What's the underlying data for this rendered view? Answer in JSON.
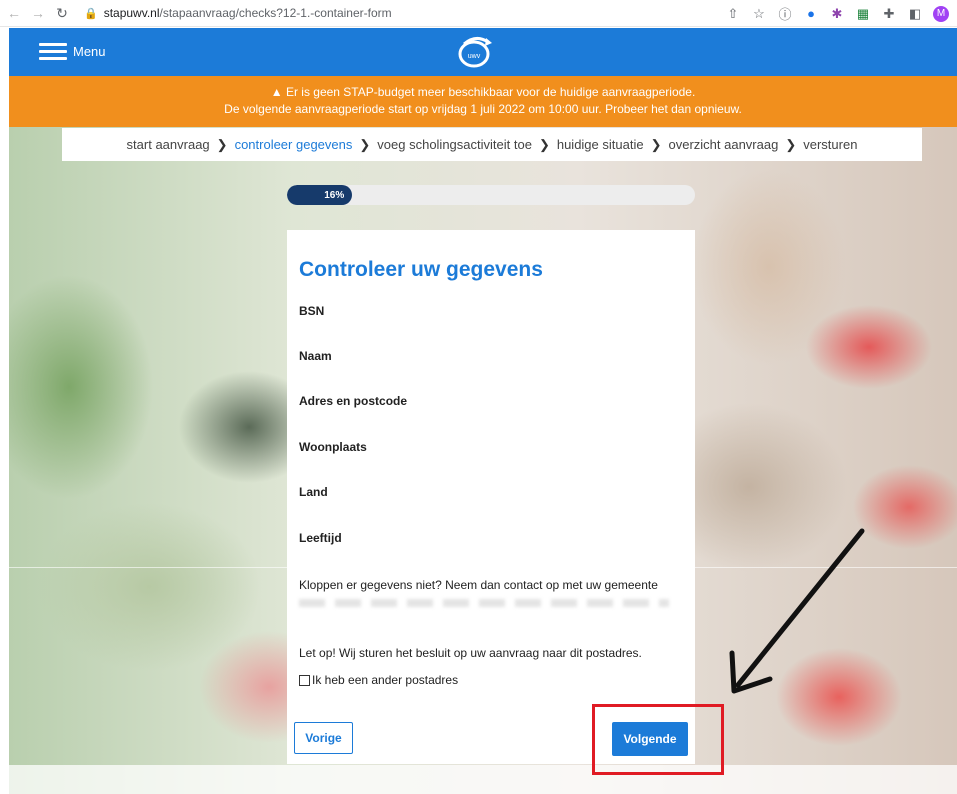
{
  "browser": {
    "url_host": "stapuwv.nl",
    "url_path": "/stapaanvraag/checks?12-1.-container-form",
    "avatar_initial": "M"
  },
  "header": {
    "menu_label": "Menu",
    "logo_text": "uwv",
    "brand_color": "#1c7bd8"
  },
  "banner": {
    "line1": "Er is geen STAP-budget meer beschikbaar voor de huidige aanvraagperiode.",
    "line2": "De volgende aanvraagperiode start op vrijdag 1 juli 2022 om 10:00 uur. Probeer het dan opnieuw.",
    "color": "#f18f1d"
  },
  "breadcrumb": {
    "steps": [
      "start aanvraag",
      "controleer gegevens",
      "voeg scholingsactiviteit toe",
      "huidige situatie",
      "overzicht aanvraag",
      "versturen"
    ],
    "active_index": 1
  },
  "progress": {
    "label": "16%",
    "fraction": 0.16
  },
  "form": {
    "title": "Controleer uw gegevens",
    "fields": [
      "BSN",
      "Naam",
      "Adres en postcode",
      "Woonplaats",
      "Land",
      "Leeftijd"
    ],
    "contact_text": "Kloppen er gegevens niet? Neem dan contact op met uw gemeente",
    "warning_text": "Let op! Wij sturen het besluit op uw aanvraag naar dit postadres.",
    "checkbox_label": "Ik heb een ander postadres",
    "prev_label": "Vorige",
    "next_label": "Volgende"
  },
  "annotation": {
    "color": "#e01b24"
  }
}
